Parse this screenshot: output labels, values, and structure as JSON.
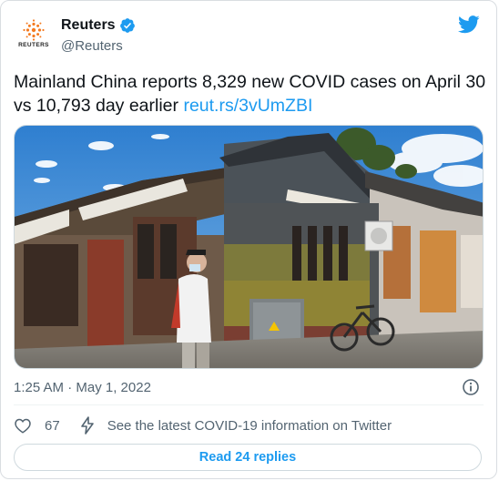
{
  "author": {
    "name": "Reuters",
    "handle": "@Reuters",
    "avatar_wordmark": "REUTERS",
    "verified": true
  },
  "tweet": {
    "text": "Mainland China reports 8,329 new COVID cases on April 30 vs 10,793 day earlier ",
    "link": "reut.rs/3vUmZBI",
    "timestamp": "1:25 AM · May 1, 2022"
  },
  "actions": {
    "like_count": "67",
    "covid_info": "See the latest COVID-19 information on Twitter"
  },
  "replies_button": "Read 24 replies",
  "colors": {
    "accent": "#1d9bf0",
    "secondary_text": "#536471",
    "reuters_orange": "#f47b20"
  },
  "icons": [
    "twitter-logo-icon",
    "verified-badge-icon",
    "info-icon",
    "heart-icon",
    "lightning-icon"
  ]
}
